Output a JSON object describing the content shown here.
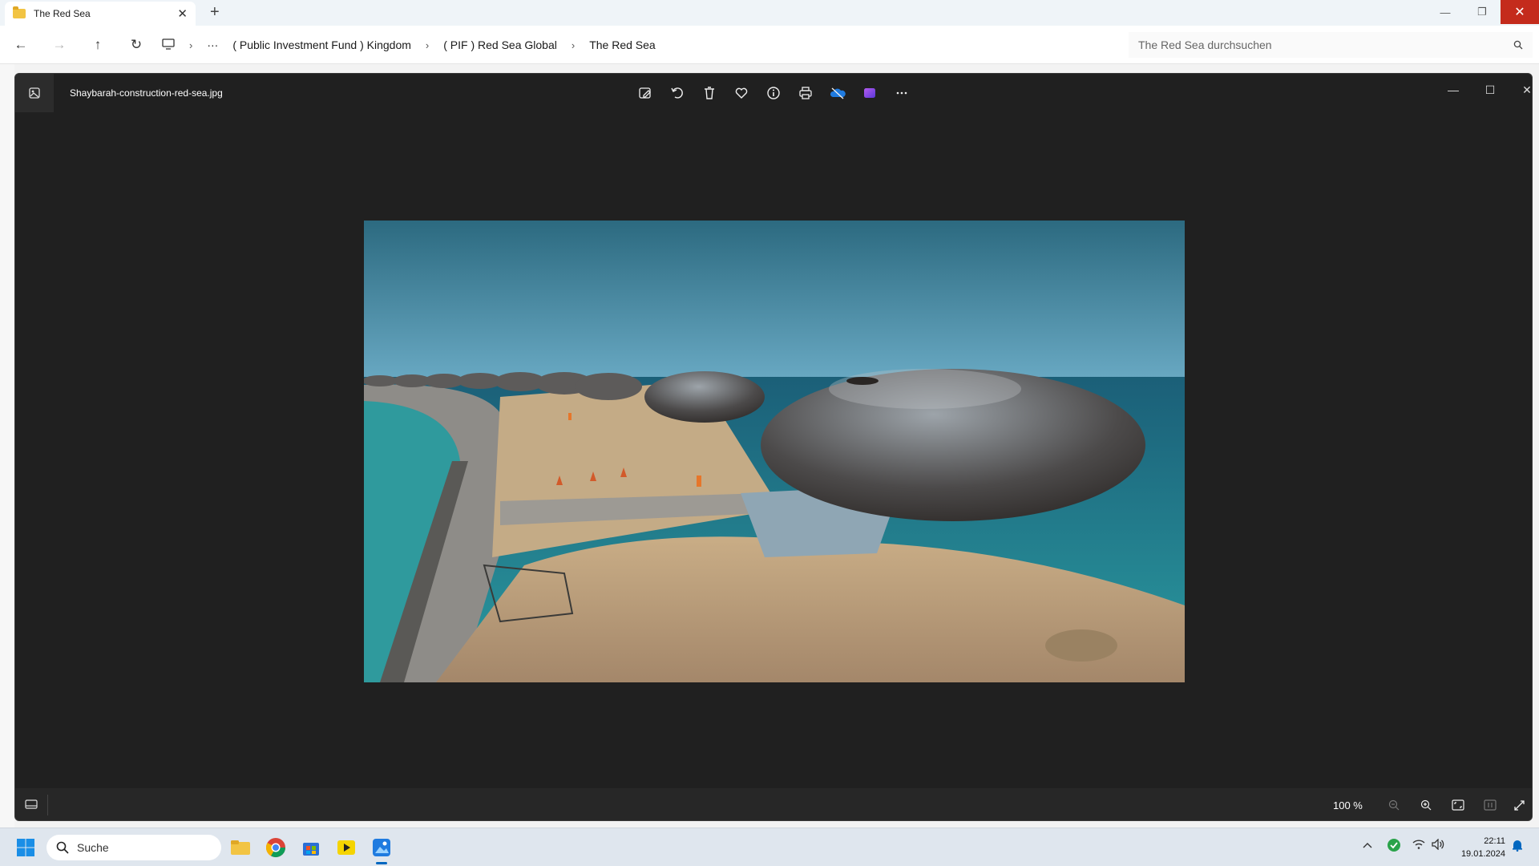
{
  "explorer": {
    "tab_title": "The Red Sea",
    "breadcrumbs": [
      "( Public Investment Fund ) Kingdom",
      "( PIF ) Red Sea Global",
      "The Red Sea"
    ],
    "search_placeholder": "The Red Sea durchsuchen"
  },
  "viewer": {
    "filename": "Shaybarah-construction-red-sea.jpg",
    "zoom_level": "100 %",
    "toolbar_icons": [
      "edit-image-icon",
      "rotate-icon",
      "delete-icon",
      "favorite-heart-icon",
      "file-info-icon",
      "print-icon",
      "onedrive-icon",
      "clipchamp-icon",
      "more-options-icon"
    ]
  },
  "taskbar": {
    "search_label": "Suche",
    "time": "22:11",
    "date": "19.01.2024"
  }
}
